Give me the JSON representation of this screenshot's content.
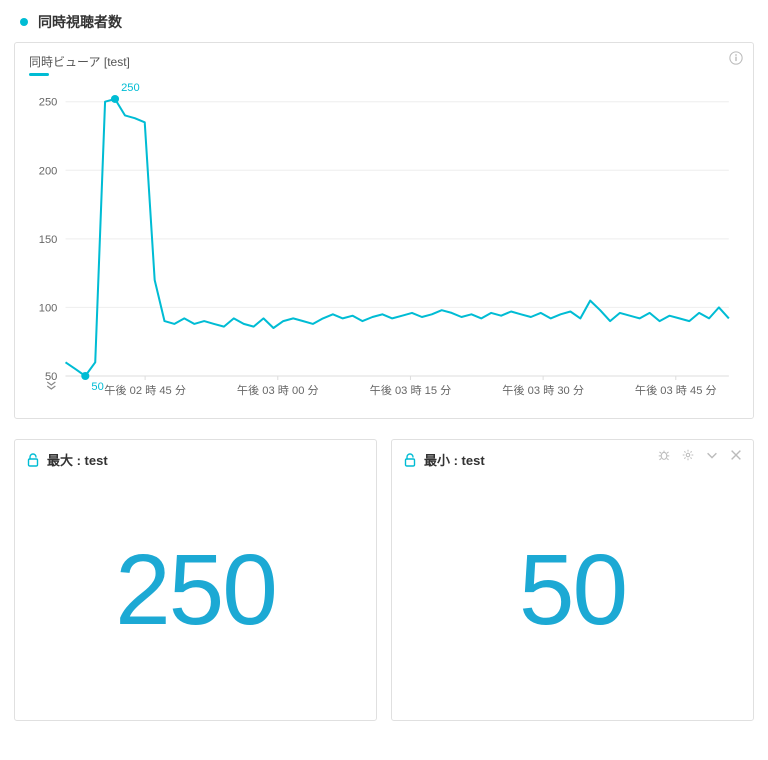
{
  "header": {
    "title": "同時視聴者数"
  },
  "chart": {
    "legend_label": "同時ビューア [test]",
    "annotations": {
      "peak": "250",
      "low": "50"
    }
  },
  "chart_data": {
    "type": "line",
    "title": "同時視聴者数",
    "series_name": "同時ビューア [test]",
    "ylim": [
      50,
      260
    ],
    "yticks": [
      50,
      100,
      150,
      200,
      250
    ],
    "x_tick_labels": [
      "午後 02 時 45 分",
      "午後 03 時 00 分",
      "午後 03 時 15 分",
      "午後 03 時 30 分",
      "午後 03 時 45 分"
    ],
    "values": [
      60,
      55,
      50,
      60,
      250,
      252,
      240,
      238,
      235,
      120,
      90,
      88,
      92,
      88,
      90,
      88,
      86,
      92,
      88,
      86,
      92,
      85,
      90,
      92,
      90,
      88,
      92,
      95,
      92,
      94,
      90,
      93,
      95,
      92,
      94,
      96,
      93,
      95,
      98,
      96,
      93,
      95,
      92,
      96,
      94,
      97,
      95,
      93,
      96,
      92,
      95,
      97,
      92,
      105,
      98,
      90,
      96,
      94,
      92,
      96,
      90,
      94,
      92,
      90,
      96,
      92,
      100,
      92
    ],
    "annotations": [
      {
        "label": "250",
        "index": 5,
        "value": 252
      },
      {
        "label": "50",
        "index": 2,
        "value": 50
      }
    ]
  },
  "stats": {
    "max": {
      "title": "最大 : test",
      "value": "250"
    },
    "min": {
      "title": "最小 : test",
      "value": "50"
    }
  },
  "colors": {
    "accent": "#00bcd4",
    "big_number": "#1ca9d4"
  }
}
